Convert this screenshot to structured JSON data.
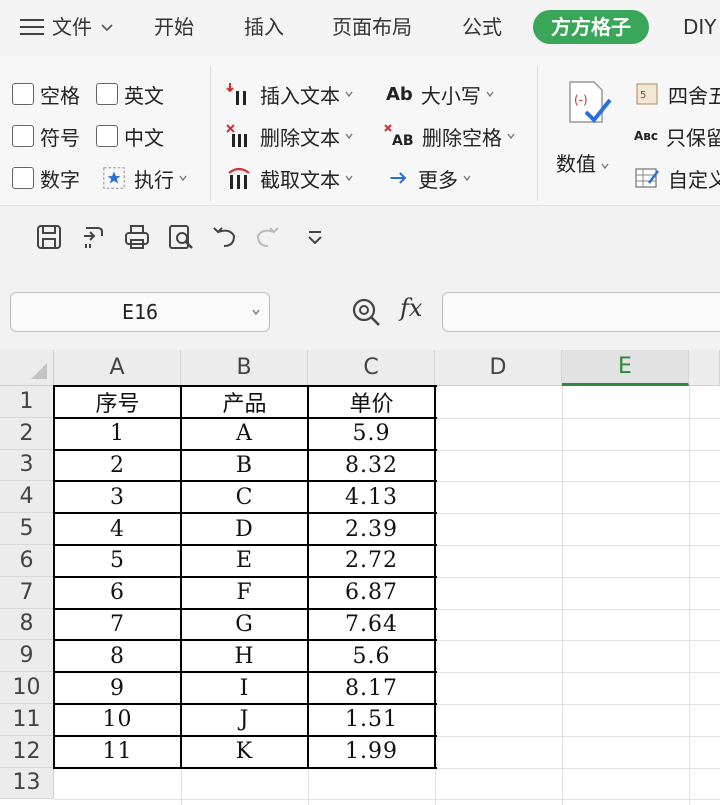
{
  "menubar": {
    "file_label": "文件",
    "tabs": [
      {
        "label": "开始",
        "active": false
      },
      {
        "label": "插入",
        "active": false
      },
      {
        "label": "页面布局",
        "active": false
      },
      {
        "label": "公式",
        "active": false
      },
      {
        "label": "方方格子",
        "active": true
      },
      {
        "label": "DIY",
        "active": false
      }
    ]
  },
  "ribbon": {
    "checkboxes": [
      "空格",
      "英文",
      "符号",
      "中文",
      "数字"
    ],
    "execute_label": "执行",
    "text_tools": [
      "插入文本",
      "删除文本",
      "截取文本"
    ],
    "case_tools": [
      "大小写",
      "删除空格",
      "更多"
    ],
    "value_label": "数值",
    "right_tools": [
      "四舍五",
      "只保留",
      "自定义"
    ]
  },
  "formula_bar": {
    "name_box": "E16",
    "fx_label": "fx",
    "formula_value": ""
  },
  "sheet": {
    "columns": [
      "A",
      "B",
      "C",
      "D",
      "E"
    ],
    "active_column": "E",
    "rows": [
      "1",
      "2",
      "3",
      "4",
      "5",
      "6",
      "7",
      "8",
      "9",
      "10",
      "11",
      "12",
      "13"
    ],
    "table": {
      "headers": [
        "序号",
        "产品",
        "单价"
      ],
      "records": [
        [
          "1",
          "A",
          "5.9"
        ],
        [
          "2",
          "B",
          "8.32"
        ],
        [
          "3",
          "C",
          "4.13"
        ],
        [
          "4",
          "D",
          "2.39"
        ],
        [
          "5",
          "E",
          "2.72"
        ],
        [
          "6",
          "F",
          "6.87"
        ],
        [
          "7",
          "G",
          "7.64"
        ],
        [
          "8",
          "H",
          "5.6"
        ],
        [
          "9",
          "I",
          "8.17"
        ],
        [
          "10",
          "J",
          "1.51"
        ],
        [
          "11",
          "K",
          "1.99"
        ]
      ]
    }
  },
  "colors": {
    "accent": "#3aa65a",
    "active_col": "#2b8a3e",
    "header_bg": "#ececec"
  }
}
